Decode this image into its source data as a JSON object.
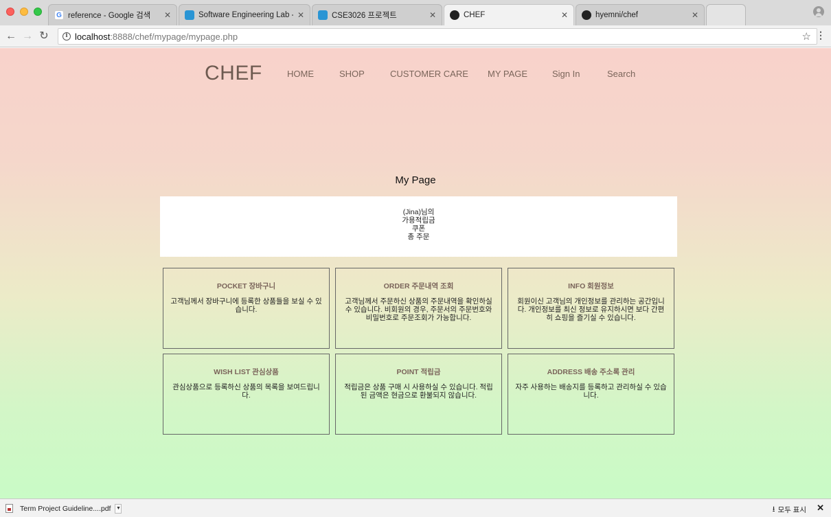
{
  "browser": {
    "tabs": [
      {
        "title": "reference - Google 검색",
        "icon": "google-icon",
        "icon_color": "#4285f4"
      },
      {
        "title": "Software Engineering Lab - Co",
        "icon": "site-icon",
        "icon_color": "#2a95d4"
      },
      {
        "title": "CSE3026 프로젝트",
        "icon": "site-icon",
        "icon_color": "#2a95d4"
      },
      {
        "title": "CHEF",
        "icon": "github-icon",
        "icon_color": "#222222"
      },
      {
        "title": "hyemni/chef",
        "icon": "github-icon",
        "icon_color": "#222222"
      }
    ],
    "active_tab": 3,
    "url": {
      "host": "localhost",
      "path": ":8888/chef/mypage/mypage.php"
    }
  },
  "site": {
    "brand": "CHEF",
    "nav": [
      "HOME",
      "SHOP",
      "CUSTOMER CARE",
      "MY PAGE",
      "Sign In",
      "Search"
    ],
    "page_title": "My Page",
    "summary": {
      "greeting": "(Jina)님의",
      "points": "가용적립금",
      "coupon": "쿠폰",
      "orders": "총 주문"
    },
    "cards": [
      {
        "title": "POCKET 장바구니",
        "desc": "고객님께서 장바구니에 등록한 상품들을 보실 수 있습니다."
      },
      {
        "title": "ORDER 주문내역 조회",
        "desc": "고객님께서 주문하신 상품의 주문내역을 확인하실 수 있습니다. 비회원의 경우, 주문서의 주문번호와 비밀번호로 주문조회가 가능합니다."
      },
      {
        "title": "INFO 회원정보",
        "desc": "회원이신 고객님의 개인정보를 관리하는 공간입니다. 개인정보를 최신 정보로 유지하시면 보다 간편히 쇼핑을 즐기실 수 있습니다."
      },
      {
        "title": "WISH LIST 관심상품",
        "desc": "관심상품으로 등록하신 상품의 목록을 보여드립니다."
      },
      {
        "title": "POINT 적립금",
        "desc": "적립금은 상품 구매 시 사용하실 수 있습니다. 적립된 금액은 현금으로 환불되지 않습니다."
      },
      {
        "title": "ADDRESS 배송 주소록 관리",
        "desc": "자주 사용하는 배송지를 등록하고 관리하실 수 있습니다."
      }
    ]
  },
  "downloads": {
    "file": "Term Project Guideline....pdf",
    "show_all": "모두 표시"
  }
}
